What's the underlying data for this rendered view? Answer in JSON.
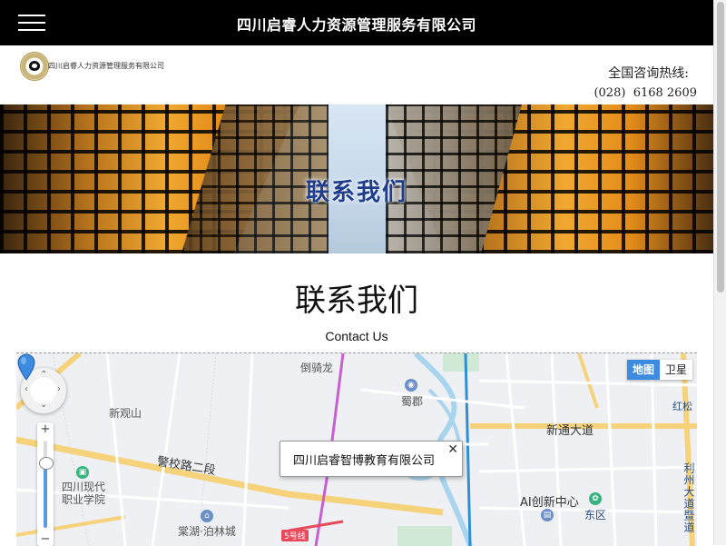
{
  "topbar": {
    "title": "四川启睿人力资源管理服务有限公司"
  },
  "header": {
    "logo_text": "四川启睿人力资源管理服务有限公司",
    "hotline_label": "全国咨询热线:",
    "hotline_number": "(028)  6168 2609"
  },
  "banner": {
    "text": "联系我们"
  },
  "main": {
    "title": "联系我们",
    "subtitle": "Contact Us"
  },
  "map": {
    "type_tabs": [
      "地图",
      "卫星"
    ],
    "active_tab": "地图",
    "infobox_text": "四川启睿智博教育有限公司",
    "zoom_level_fraction": 0.75,
    "labels": {
      "daoqilong": "倒骑龙",
      "xinguanshan": "新观山",
      "shujun": "蜀郡",
      "xintongdadao": "新通大道",
      "jingxiaolu": "警校路二段",
      "sichuan_college_1": "四川现代",
      "sichuan_college_2": "职业学院",
      "aichuangxin": "AI创新中心",
      "dongqu": "东区",
      "tanghu": "棠湖·泊林城",
      "line5": "5号线",
      "hongsong": "红松",
      "lizhoudadao": "利州大道暨道"
    }
  },
  "colors": {
    "topbar_bg": "#000000",
    "banner_text": "#1f3d8a",
    "map_active_tab": "#3d8be0"
  }
}
